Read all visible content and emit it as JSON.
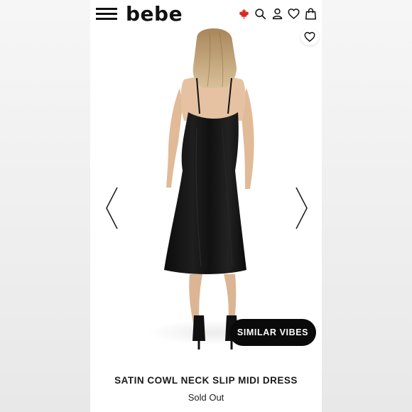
{
  "brand": {
    "logo_text": "bebe"
  },
  "header": {
    "icons": [
      "menu-icon",
      "canada-flag-icon",
      "search-icon",
      "account-icon",
      "wishlist-icon",
      "shopping-bag-icon"
    ]
  },
  "gallery": {
    "similar_button_label": "SIMILAR VIBES",
    "icons": [
      "chevron-left-icon",
      "chevron-right-icon",
      "heart-icon"
    ]
  },
  "product": {
    "name": "SATIN COWL NECK SLIP MIDI DRESS",
    "status": "Sold Out"
  },
  "colors": {
    "text": "#111111",
    "button_bg": "#0a0a0a",
    "button_text": "#ffffff",
    "flag_red": "#d52b1e"
  }
}
